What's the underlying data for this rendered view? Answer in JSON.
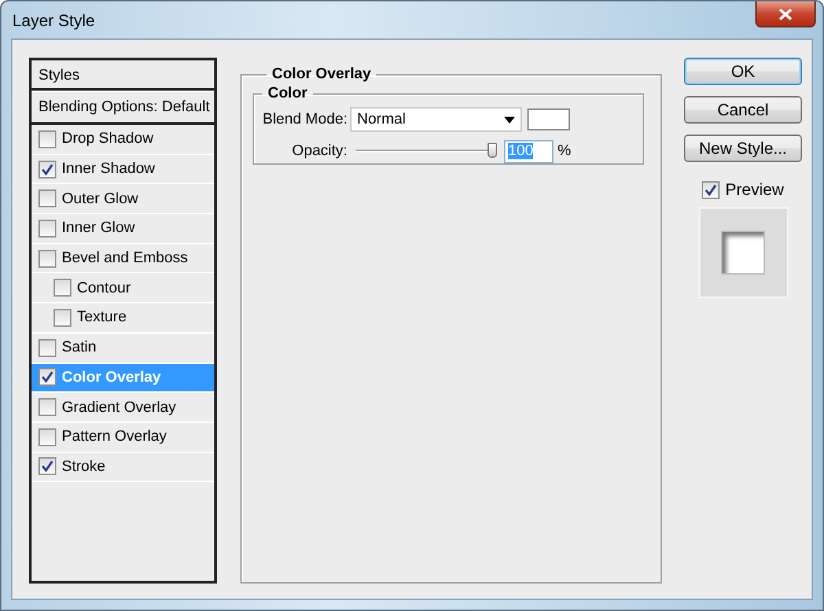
{
  "window": {
    "title": "Layer Style"
  },
  "styles_panel": {
    "header": "Styles",
    "blending_options": "Blending Options: Default",
    "items": [
      {
        "label": "Drop Shadow",
        "checked": false,
        "selected": false
      },
      {
        "label": "Inner Shadow",
        "checked": true,
        "selected": false
      },
      {
        "label": "Outer Glow",
        "checked": false,
        "selected": false
      },
      {
        "label": "Inner Glow",
        "checked": false,
        "selected": false
      },
      {
        "label": "Bevel and Emboss",
        "checked": false,
        "selected": false,
        "children": [
          {
            "label": "Contour",
            "checked": false,
            "selected": false
          },
          {
            "label": "Texture",
            "checked": false,
            "selected": false
          }
        ]
      },
      {
        "label": "Satin",
        "checked": false,
        "selected": false
      },
      {
        "label": "Color Overlay",
        "checked": true,
        "selected": true
      },
      {
        "label": "Gradient Overlay",
        "checked": false,
        "selected": false
      },
      {
        "label": "Pattern Overlay",
        "checked": false,
        "selected": false
      },
      {
        "label": "Stroke",
        "checked": true,
        "selected": false
      }
    ]
  },
  "color_overlay": {
    "title": "Color Overlay",
    "group_title": "Color",
    "blend_mode_label": "Blend Mode:",
    "blend_mode": "Normal",
    "opacity_label": "Opacity:",
    "opacity": {
      "level": 1,
      "value": "100",
      "unit": "%"
    }
  },
  "buttons": [
    {
      "label": "OK",
      "default": true
    },
    {
      "label": "Cancel",
      "default": false
    },
    {
      "label": "New Style...",
      "default": false
    }
  ],
  "preview": {
    "label": "Preview",
    "checked": true
  }
}
